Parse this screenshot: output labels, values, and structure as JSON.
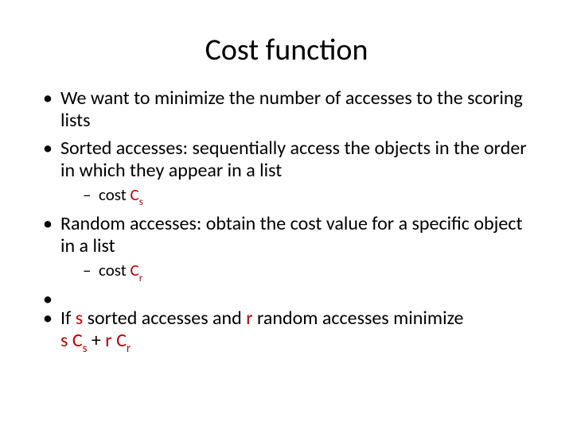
{
  "title": "Cost function",
  "bullets": {
    "b1": "We want to minimize the number of accesses to the scoring lists",
    "b2_pre": "Sorted accesses",
    "b2_post": ": sequentially access the objects in the order in which they appear in a list",
    "b2_sub_pre": "cost ",
    "b2_sub_C": "C",
    "b2_sub_s": "s",
    "b3_pre": "Random accesses",
    "b3_post": ": obtain the cost value for a specific object in a list",
    "b3_sub_pre": "cost ",
    "b3_sub_C": "C",
    "b3_sub_r": "r",
    "b4_1": "If ",
    "b4_s": "s",
    "b4_2": " sorted accesses and ",
    "b4_r": "r",
    "b4_3": " random accesses minimize ",
    "b4_expr_s": "s",
    "b4_expr_sp1": " ",
    "b4_expr_Cs_C": "C",
    "b4_expr_Cs_s": "s",
    "b4_expr_plus": " + ",
    "b4_expr_r": "r",
    "b4_expr_sp2": " ",
    "b4_expr_Cr_C": "C",
    "b4_expr_Cr_r": "r"
  }
}
